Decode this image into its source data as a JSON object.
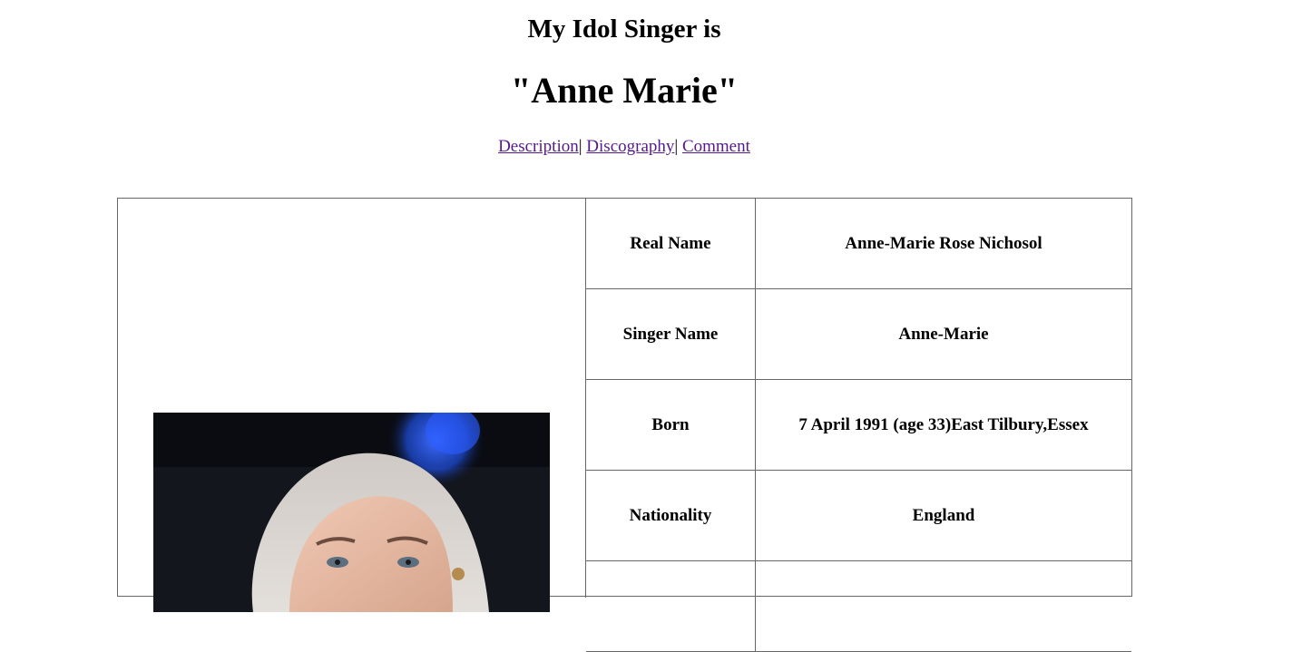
{
  "page": {
    "heading_small": "My Idol Singer is",
    "heading_large": "\"Anne Marie\""
  },
  "nav": {
    "items": [
      {
        "label": "Description"
      },
      {
        "label": "Discography"
      },
      {
        "label": "Comment"
      }
    ],
    "separator": "|"
  },
  "info_table": {
    "rows": [
      {
        "key": "Real Name",
        "value": "Anne-Marie Rose Nichosol"
      },
      {
        "key": "Singer Name",
        "value": "Anne-Marie"
      },
      {
        "key": "Born",
        "value": "7 April 1991 (age 33)East Tilbury,Essex"
      },
      {
        "key": "Nationality",
        "value": "England"
      },
      {
        "key": "",
        "value": ""
      }
    ]
  },
  "colors": {
    "link": "#551a8b",
    "table_border": "#666666",
    "photo_background": "#0a0c12",
    "stage_light": "#1f4fe0",
    "hair": "#d8d4d0",
    "skin": "#e8bfa8"
  }
}
